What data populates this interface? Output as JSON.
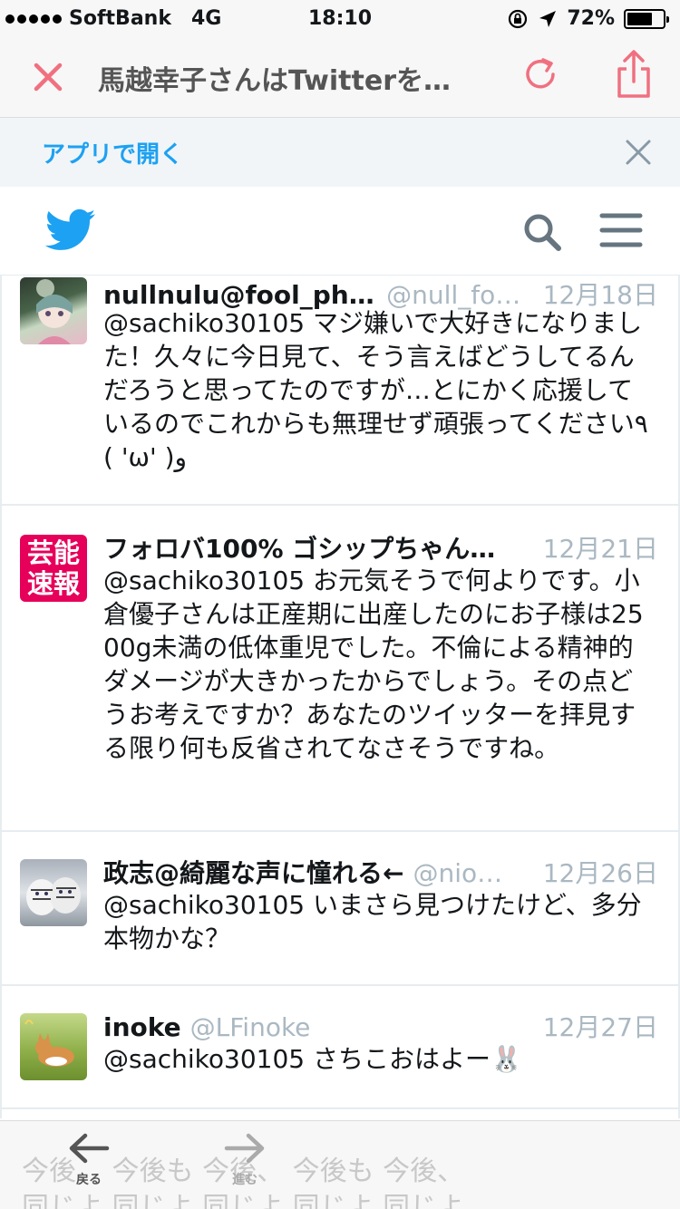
{
  "status": {
    "carrier": "SoftBank",
    "network": "4G",
    "time": "18:10",
    "battery": "72%",
    "battery_level": 0.72
  },
  "browser": {
    "title": "馬越幸子さんはTwitterを…",
    "back_label": "戻る",
    "forward_label": "進む",
    "accent": "#f07080"
  },
  "banner": {
    "open_app": "アプリで開く"
  },
  "tweets": [
    {
      "name": "nullnulu@fool_phool",
      "handle": "@null_foo…",
      "date": "12月18日",
      "text": "@sachiko30105 マジ嫌いで大好きになりました！久々に今日見て、そう言えばどうしてるんだろうと思ってたのですが…とにかく応援しているのでこれからも無理せず頑張ってください٩( 'ω' )و"
    },
    {
      "name": "フォロバ100% ゴシップちゃん…",
      "handle": "",
      "date": "12月21日",
      "text": "@sachiko30105 お元気そうで何よりです。小倉優子さんは正産期に出産したのにお子様は2500g未満の低体重児でした。不倫による精神的ダメージが大きかったからでしょう。その点どうお考えですか？あなたのツイッターを拝見する限り何も反省されてなさそうですね。",
      "avatar_text": "芸能速報"
    },
    {
      "name": "政志@綺麗な声に憧れる←",
      "handle": "@nio…",
      "date": "12月26日",
      "text": "@sachiko30105 いまさら見つけたけど、多分本物かな？"
    },
    {
      "name": "inoke",
      "handle": "@LFinoke",
      "date": "12月27日",
      "text": "@sachiko30105 さちこおはよー🐰"
    }
  ],
  "ghost_text": {
    "line1": "今後、  今後も  今後、  今後も  今後、",
    "line2": "同じよ  同じよ  同じよ  同じよ  同じよ"
  }
}
